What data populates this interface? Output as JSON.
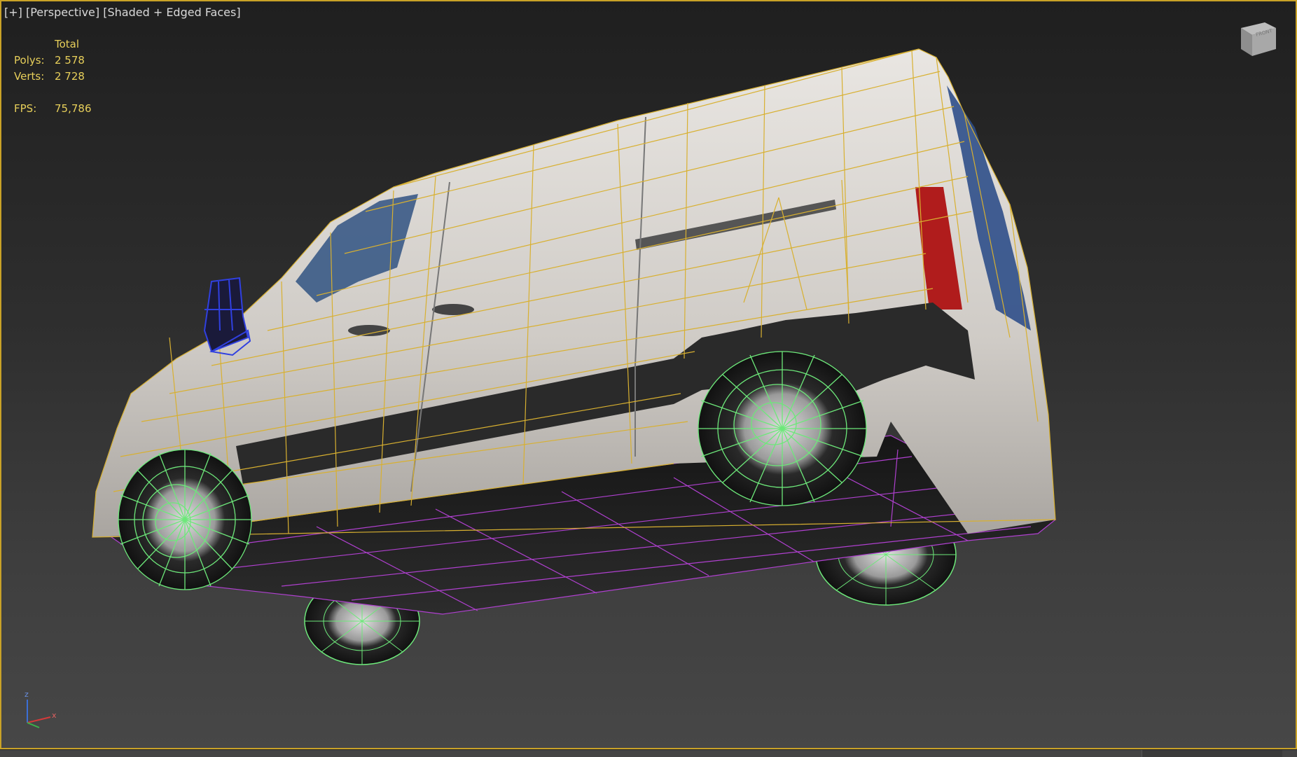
{
  "viewport": {
    "label_plus": "[+]",
    "label_view": "[Perspective]",
    "label_shading": "[Shaded + Edged Faces]"
  },
  "stats": {
    "header": "Total",
    "polys_label": "Polys:",
    "polys_value": "2 578",
    "verts_label": "Verts:",
    "verts_value": "2 728",
    "fps_label": "FPS:",
    "fps_value": "75,786"
  },
  "viewcube": {
    "face_label": "FRONT"
  },
  "axis": {
    "z_label": "z",
    "x_label": "x"
  },
  "colors": {
    "border_active": "#c9a227",
    "stats_text": "#e7cf5a",
    "wire_body": "#d8b030",
    "wire_wheels": "#6de87a",
    "wire_underside": "#b040d0",
    "wire_mirror": "#3040e0"
  },
  "icons": {
    "viewcube": "viewcube-icon",
    "axis": "axis-tripod-icon"
  }
}
